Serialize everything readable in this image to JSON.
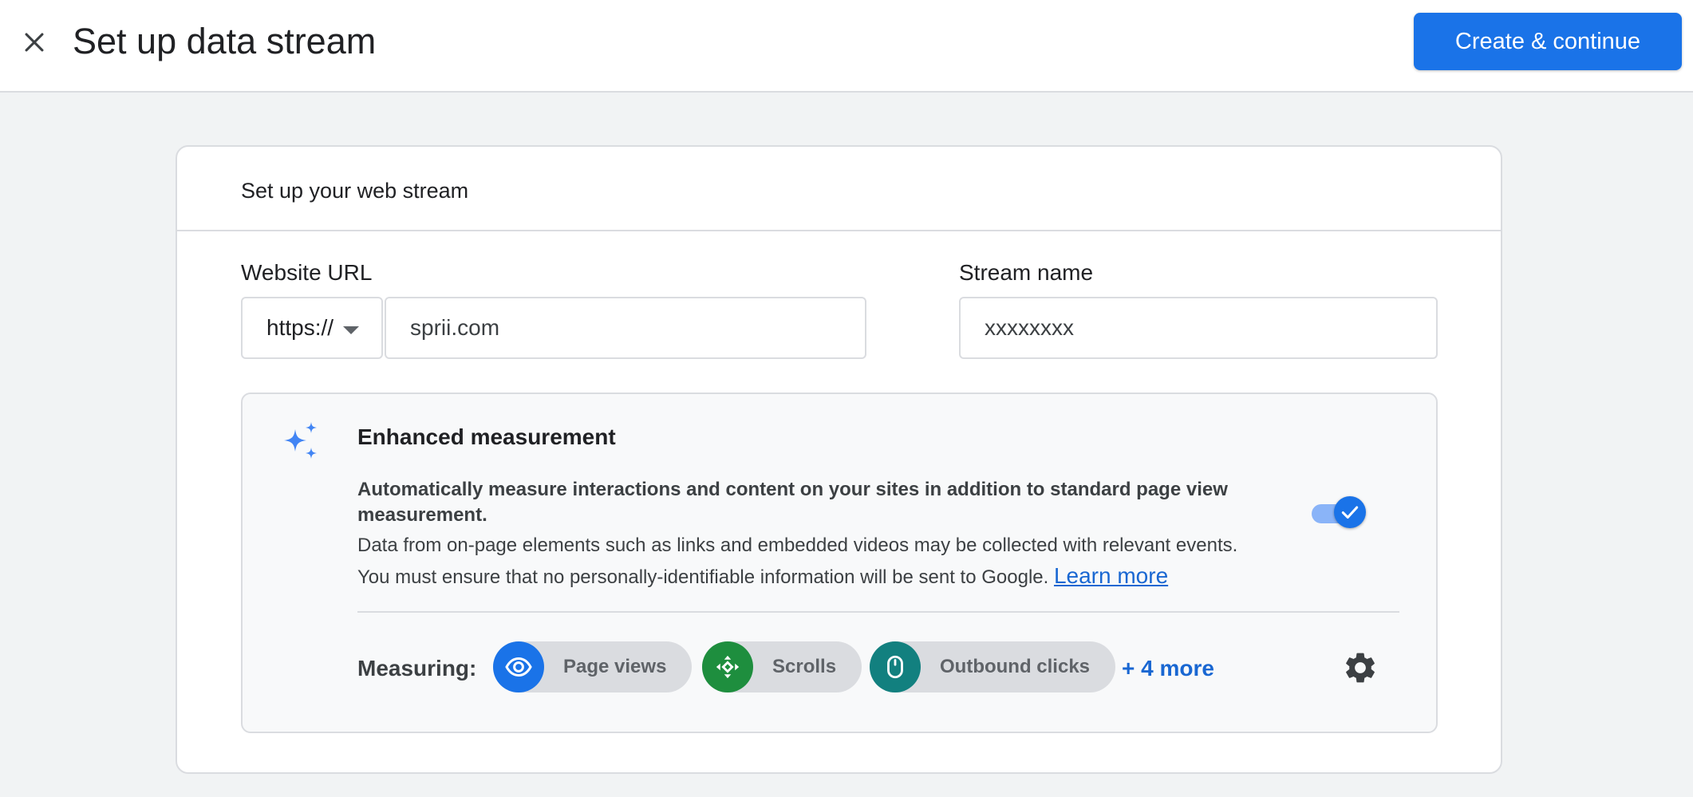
{
  "header": {
    "title": "Set up data stream",
    "primary_button": "Create & continue",
    "close_icon": "close-icon"
  },
  "card": {
    "title": "Set up your web stream",
    "website_url": {
      "label": "Website URL",
      "scheme": "https://",
      "value": "sprii.com"
    },
    "stream_name": {
      "label": "Stream name",
      "value": "xxxxxxxx"
    },
    "enhanced_measurement": {
      "icon": "sparkle-icon",
      "title": "Enhanced measurement",
      "description_bold": "Automatically measure interactions and content on your sites in addition to standard page view measurement.",
      "description_line1": "Data from on-page elements such as links and embedded videos may be collected with relevant events.",
      "description_line2": "You must ensure that no personally-identifiable information will be sent to Google.",
      "learn_more": "Learn more",
      "toggle_on": true,
      "measuring_label": "Measuring:",
      "chips": [
        {
          "label": "Page views",
          "icon": "eye-icon",
          "color": "#1a73e8"
        },
        {
          "label": "Scrolls",
          "icon": "scroll-arrows-icon",
          "color": "#1e8e3e"
        },
        {
          "label": "Outbound clicks",
          "icon": "mouse-icon",
          "color": "#12807f"
        }
      ],
      "more_link": "+ 4 more",
      "settings_icon": "gear-icon"
    }
  },
  "colors": {
    "accent": "#1a73e8",
    "background": "#f1f3f4"
  }
}
